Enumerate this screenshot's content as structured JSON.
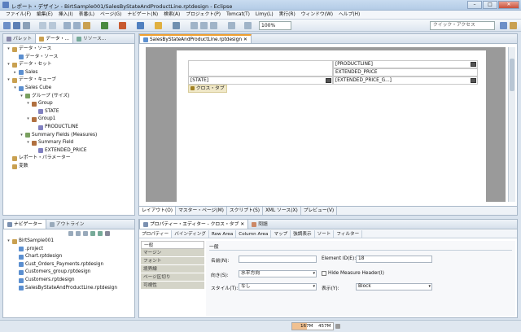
{
  "window": {
    "title": "レポート・デザイン - BirtSample001/SalesByStateAndProductLine.rptdesign - Eclipse"
  },
  "menu": [
    "ファイル(F)",
    "編集(E)",
    "挿入(I)",
    "表番(L)",
    "ページ(G)",
    "ナビゲート(N)",
    "検索(A)",
    "プロジェクト(P)",
    "Tomcat(T)",
    "Limy(L)",
    "実行(R)",
    "ウィンドウ(W)",
    "ヘルプ(H)"
  ],
  "toolbar": {
    "zoom": "100%",
    "quick_access": "クイック・アクセス"
  },
  "left_pane": {
    "tabs": [
      "パレット",
      "データ・...",
      "リソース..."
    ],
    "tree": [
      {
        "label": "データ・ソース",
        "level": 0,
        "exp": "▾"
      },
      {
        "label": "データ・ソース",
        "level": 1,
        "exp": ""
      },
      {
        "label": "データ・セット",
        "level": 0,
        "exp": "▾"
      },
      {
        "label": "Sales",
        "level": 1,
        "exp": "▸"
      },
      {
        "label": "データ・キューブ",
        "level": 0,
        "exp": "▾"
      },
      {
        "label": "Sales Cube",
        "level": 1,
        "exp": "▾"
      },
      {
        "label": "グループ (サイズ)",
        "level": 2,
        "exp": "▾"
      },
      {
        "label": "Group",
        "level": 3,
        "exp": "▾"
      },
      {
        "label": "STATE",
        "level": 4,
        "exp": ""
      },
      {
        "label": "Group1",
        "level": 3,
        "exp": "▾"
      },
      {
        "label": "PRODUCTLINE",
        "level": 4,
        "exp": ""
      },
      {
        "label": "Summary Fields (Measures)",
        "level": 2,
        "exp": "▾"
      },
      {
        "label": "Summary Field",
        "level": 3,
        "exp": "▾"
      },
      {
        "label": "EXTENDED_PRICE",
        "level": 4,
        "exp": ""
      },
      {
        "label": "レポート・パラメーター",
        "level": 0,
        "exp": ""
      },
      {
        "label": "変数",
        "level": 0,
        "exp": ""
      }
    ]
  },
  "editor": {
    "tab": "SalesByStateAndProductLine.rptdesign",
    "cells": {
      "productline": "[PRODUCTLINE]",
      "extended_price": "EXTENDED_PRICE",
      "state": "[STATE]",
      "ext_price_g": "[EXTENDED_PRICE_G...]",
      "crosstab": "クロス・タブ"
    },
    "bottom_tabs": [
      "レイアウト(O)",
      "マスター・ページ(M)",
      "スクリプト(S)",
      "XML ソース(X)",
      "プレビュー(V)"
    ]
  },
  "navigator": {
    "tabs": [
      "ナビゲーター",
      "アウトライン"
    ],
    "tree": [
      {
        "label": "BirtSample001",
        "level": 0,
        "exp": "▾"
      },
      {
        "label": ".project",
        "level": 1
      },
      {
        "label": "Chart.rptdesign",
        "level": 1
      },
      {
        "label": "Cust_Orders_Payments.rptdesign",
        "level": 1
      },
      {
        "label": "Customers_group.rptdesign",
        "level": 1
      },
      {
        "label": "Customers.rptdesign",
        "level": 1
      },
      {
        "label": "SalesByStateAndProductLine.rptdesign",
        "level": 1
      }
    ]
  },
  "properties": {
    "tabs": [
      "プロパティー・エディター - クロス・タブ",
      "問題"
    ],
    "subtabs": [
      "プロパティー",
      "バインディング",
      "Row Area",
      "Column Area",
      "マップ",
      "強調表示",
      "ソート",
      "フィルター"
    ],
    "nav": [
      "一般",
      "マージン",
      "フォント",
      "境界線",
      "ページ区切り",
      "可視性"
    ],
    "section": "一般",
    "fields": {
      "name_label": "名前(N):",
      "name_value": "",
      "element_id_label": "Element ID(E):",
      "element_id_value": "18",
      "direction_label": "向き(S):",
      "direction_value": "水平方向",
      "hide_measure": "Hide Measure Header(I)",
      "style_label": "スタイル(T):",
      "style_value": "なし",
      "display_label": "表示(Y):",
      "display_value": "Block"
    }
  },
  "status": {
    "mem_used": "167M",
    "mem_total": "457M",
    "mem_fraction": 0.365
  }
}
